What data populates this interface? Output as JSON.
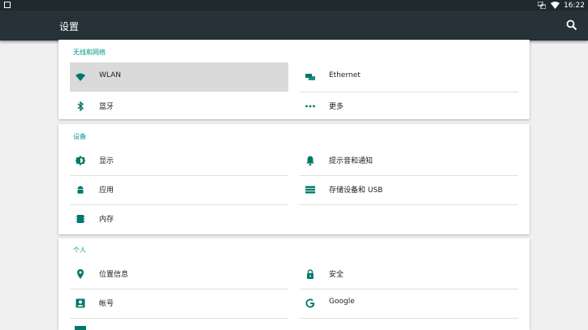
{
  "statusbar": {
    "time": "16:22"
  },
  "appbar": {
    "title": "设置"
  },
  "sections": [
    {
      "title": "无线和网络",
      "items": [
        {
          "label": "WLAN",
          "icon": "wifi-icon"
        },
        {
          "label": "Ethernet",
          "icon": "ethernet-icon"
        },
        {
          "label": "蓝牙",
          "icon": "bluetooth-icon"
        },
        {
          "label": "更多",
          "icon": "more-icon"
        }
      ]
    },
    {
      "title": "设备",
      "items": [
        {
          "label": "显示",
          "icon": "brightness-icon"
        },
        {
          "label": "提示音和通知",
          "icon": "bell-icon"
        },
        {
          "label": "应用",
          "icon": "android-icon"
        },
        {
          "label": "存储设备和 USB",
          "icon": "storage-icon"
        },
        {
          "label": "内存",
          "icon": "memory-icon"
        }
      ]
    },
    {
      "title": "个人",
      "items": [
        {
          "label": "位置信息",
          "icon": "location-icon"
        },
        {
          "label": "安全",
          "icon": "lock-icon"
        },
        {
          "label": "帐号",
          "icon": "account-icon"
        },
        {
          "label": "Google",
          "icon": "google-icon"
        }
      ]
    }
  ],
  "colors": {
    "accent": "#009688",
    "appbar": "#263238",
    "icon": "#00796b"
  }
}
